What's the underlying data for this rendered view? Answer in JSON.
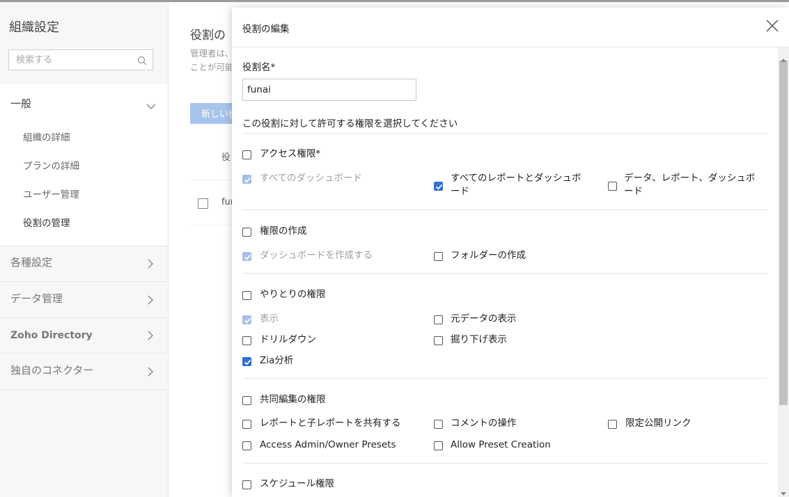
{
  "sidebar": {
    "title": "組織設定",
    "search_placeholder": "検索する",
    "general": {
      "label": "一般",
      "items": [
        "組織の詳細",
        "プランの詳細",
        "ユーザー管理",
        "役割の管理"
      ]
    },
    "sections": [
      "各種設定",
      "データ管理",
      "Zoho Directory",
      "独自のコネクター"
    ]
  },
  "main": {
    "title": "役割の",
    "desc_line1": "管理者は、",
    "desc_line2": "ことが可能",
    "new_button": "新しい役",
    "table_header": "役",
    "row_name": "fun"
  },
  "modal": {
    "title": "役割の編集",
    "role_name_label": "役割名*",
    "role_name_value": "funai",
    "permissions_prompt": "この役割に対して許可する権限を選択してください",
    "groups": {
      "access": {
        "label": "アクセス権限*",
        "items": [
          "すべてのダッシュボード",
          "すべてのレポートとダッシュボード",
          "データ、レポート、ダッシュボード"
        ]
      },
      "create": {
        "label": "権限の作成",
        "items": [
          "ダッシュボードを作成する",
          "フォルダーの作成"
        ]
      },
      "interaction": {
        "label": "やりとりの権限",
        "items": [
          "表示",
          "元データの表示",
          "ドリルダウン",
          "掘り下げ表示",
          "Zia分析"
        ]
      },
      "collab": {
        "label": "共同編集の権限",
        "items": [
          "レポートと子レポートを共有する",
          "コメントの操作",
          "限定公開リンク",
          "Access Admin/Owner Presets",
          "Allow Preset Creation"
        ]
      },
      "schedule": {
        "label": "スケジュール権限"
      }
    }
  },
  "colors": {
    "accent": "#2f6fdc",
    "disabled_check": "#a6bfe6",
    "new_button": "#a7c4ec"
  }
}
